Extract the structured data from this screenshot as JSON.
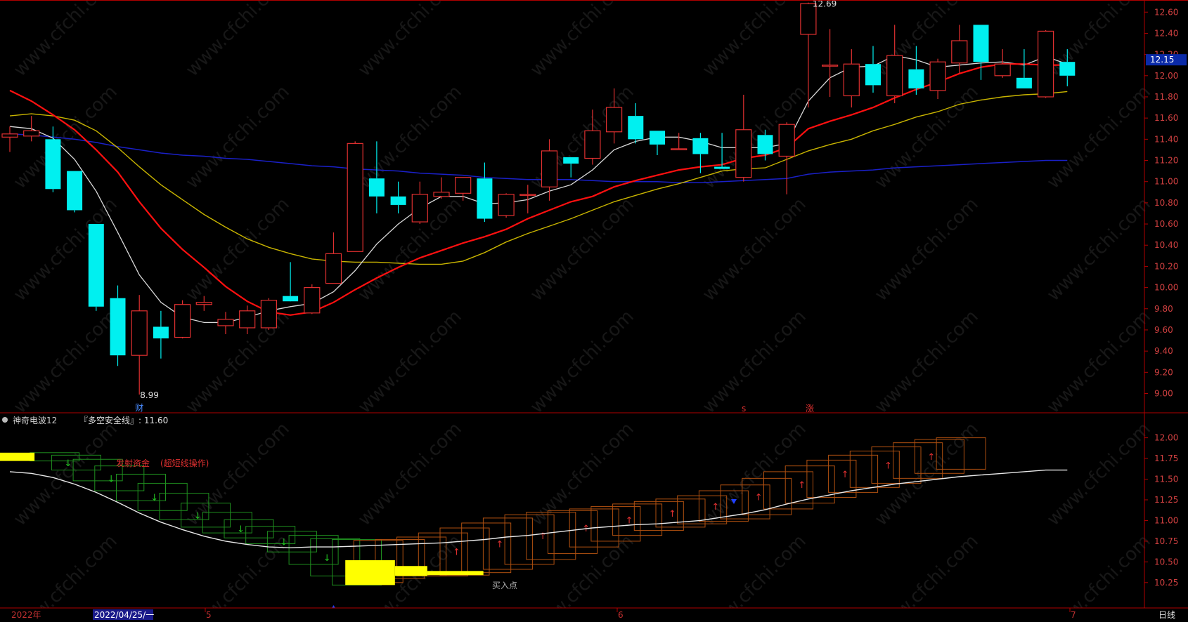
{
  "price_axis": {
    "ticks": [
      "12.60",
      "12.40",
      "12.20",
      "12.00",
      "11.80",
      "11.60",
      "11.40",
      "11.20",
      "11.00",
      "10.80",
      "10.60",
      "10.40",
      "10.20",
      "10.00",
      "9.80",
      "9.60",
      "9.40",
      "9.20",
      "9.00"
    ],
    "current_price": "12.15"
  },
  "markers": {
    "high_label": "12.69",
    "low_label": "8.99",
    "cai_label": "财",
    "s_label": "s",
    "zhang_label": "涨"
  },
  "indicator": {
    "name": "神奇电波12",
    "safety_label": "『多空安全线』: 11.60",
    "sell_text": "发射资金",
    "sell_note": "(超短线操作)",
    "buy_text": "买入点",
    "ticks": [
      "12.00",
      "11.75",
      "11.50",
      "11.25",
      "11.00",
      "10.75",
      "10.50",
      "10.25"
    ]
  },
  "time_axis": {
    "year_label": "2022年",
    "cursor_date": "2022/04/25/一",
    "month_labels": [
      "5",
      "6",
      "7"
    ],
    "period_label": "日线"
  },
  "watermark_text": "www.cfchi.com",
  "colors": {
    "up": "#e03030",
    "down": "#00f0f0",
    "ma_white": "#d8d8d8",
    "ma_red": "#ff1010",
    "ma_yellow": "#c8b400",
    "ma_blue": "#1a20c8",
    "axis_red": "#b00000",
    "yellow_bar": "#ffff00"
  },
  "chart_data": {
    "type": "candlestick",
    "y_range": [
      8.9,
      12.75
    ],
    "candles": [
      {
        "o": 11.42,
        "h": 11.52,
        "l": 11.28,
        "c": 11.45
      },
      {
        "o": 11.43,
        "h": 11.62,
        "l": 11.38,
        "c": 11.48
      },
      {
        "o": 11.4,
        "h": 11.52,
        "l": 10.9,
        "c": 10.93
      },
      {
        "o": 11.1,
        "h": 11.1,
        "l": 10.71,
        "c": 10.73
      },
      {
        "o": 10.6,
        "h": 10.6,
        "l": 9.78,
        "c": 9.82
      },
      {
        "o": 9.9,
        "h": 10.02,
        "l": 9.26,
        "c": 9.36
      },
      {
        "o": 9.36,
        "h": 9.93,
        "l": 8.99,
        "c": 9.78
      },
      {
        "o": 9.63,
        "h": 9.78,
        "l": 9.33,
        "c": 9.52
      },
      {
        "o": 9.53,
        "h": 9.88,
        "l": 9.52,
        "c": 9.84
      },
      {
        "o": 9.84,
        "h": 9.92,
        "l": 9.78,
        "c": 9.86
      },
      {
        "o": 9.64,
        "h": 9.77,
        "l": 9.56,
        "c": 9.7
      },
      {
        "o": 9.62,
        "h": 9.83,
        "l": 9.56,
        "c": 9.78
      },
      {
        "o": 9.62,
        "h": 9.9,
        "l": 9.6,
        "c": 9.88
      },
      {
        "o": 9.92,
        "h": 10.24,
        "l": 9.88,
        "c": 9.87
      },
      {
        "o": 9.76,
        "h": 10.03,
        "l": 9.75,
        "c": 10.0
      },
      {
        "o": 10.04,
        "h": 10.52,
        "l": 10.04,
        "c": 10.32
      },
      {
        "o": 10.34,
        "h": 11.38,
        "l": 10.34,
        "c": 11.36
      },
      {
        "o": 11.03,
        "h": 11.38,
        "l": 10.7,
        "c": 10.86
      },
      {
        "o": 10.86,
        "h": 11.0,
        "l": 10.7,
        "c": 10.78
      },
      {
        "o": 10.62,
        "h": 11.0,
        "l": 10.6,
        "c": 10.88
      },
      {
        "o": 10.86,
        "h": 11.04,
        "l": 10.84,
        "c": 10.9
      },
      {
        "o": 10.89,
        "h": 11.04,
        "l": 10.82,
        "c": 11.04
      },
      {
        "o": 11.03,
        "h": 11.18,
        "l": 10.62,
        "c": 10.65
      },
      {
        "o": 10.68,
        "h": 10.89,
        "l": 10.66,
        "c": 10.88
      },
      {
        "o": 10.88,
        "h": 10.97,
        "l": 10.7,
        "c": 10.88
      },
      {
        "o": 10.95,
        "h": 11.4,
        "l": 10.82,
        "c": 11.29
      },
      {
        "o": 11.23,
        "h": 11.23,
        "l": 11.04,
        "c": 11.17
      },
      {
        "o": 11.22,
        "h": 11.68,
        "l": 11.16,
        "c": 11.48
      },
      {
        "o": 11.47,
        "h": 11.88,
        "l": 11.36,
        "c": 11.7
      },
      {
        "o": 11.62,
        "h": 11.74,
        "l": 11.36,
        "c": 11.4
      },
      {
        "o": 11.48,
        "h": 11.48,
        "l": 11.25,
        "c": 11.35
      },
      {
        "o": 11.31,
        "h": 11.46,
        "l": 11.3,
        "c": 11.31
      },
      {
        "o": 11.41,
        "h": 11.46,
        "l": 11.08,
        "c": 11.26
      },
      {
        "o": 11.14,
        "h": 11.46,
        "l": 11.12,
        "c": 11.12
      },
      {
        "o": 11.04,
        "h": 11.82,
        "l": 11.0,
        "c": 11.49
      },
      {
        "o": 11.44,
        "h": 11.49,
        "l": 11.2,
        "c": 11.26
      },
      {
        "o": 11.24,
        "h": 11.56,
        "l": 10.88,
        "c": 11.54
      },
      {
        "o": 12.39,
        "h": 12.69,
        "l": 11.7,
        "c": 12.68
      },
      {
        "o": 12.09,
        "h": 12.44,
        "l": 11.8,
        "c": 12.1
      },
      {
        "o": 11.81,
        "h": 12.25,
        "l": 11.7,
        "c": 12.11
      },
      {
        "o": 12.11,
        "h": 12.28,
        "l": 11.84,
        "c": 11.91
      },
      {
        "o": 11.81,
        "h": 12.48,
        "l": 11.74,
        "c": 12.19
      },
      {
        "o": 12.06,
        "h": 12.28,
        "l": 11.82,
        "c": 11.88
      },
      {
        "o": 11.86,
        "h": 12.16,
        "l": 11.78,
        "c": 12.13
      },
      {
        "o": 12.12,
        "h": 12.48,
        "l": 12.02,
        "c": 12.33
      },
      {
        "o": 12.48,
        "h": 12.48,
        "l": 11.96,
        "c": 12.13
      },
      {
        "o": 12.0,
        "h": 12.25,
        "l": 11.98,
        "c": 12.11
      },
      {
        "o": 11.98,
        "h": 12.25,
        "l": 11.88,
        "c": 11.88
      },
      {
        "o": 11.8,
        "h": 12.43,
        "l": 11.79,
        "c": 12.42
      },
      {
        "o": 12.13,
        "h": 12.25,
        "l": 11.9,
        "c": 12.0
      }
    ],
    "ma_white": [
      11.52,
      11.5,
      11.41,
      11.21,
      10.91,
      10.52,
      10.12,
      9.86,
      9.72,
      9.67,
      9.67,
      9.72,
      9.78,
      9.82,
      9.85,
      9.96,
      10.16,
      10.41,
      10.6,
      10.75,
      10.86,
      10.86,
      10.79,
      10.8,
      10.83,
      10.91,
      10.97,
      11.11,
      11.3,
      11.38,
      11.42,
      11.42,
      11.38,
      11.32,
      11.32,
      11.32,
      11.36,
      11.76,
      11.98,
      12.08,
      12.09,
      12.19,
      12.15,
      12.08,
      12.1,
      12.12,
      12.13,
      12.1,
      12.18,
      12.11
    ],
    "ma_red": [
      11.86,
      11.76,
      11.63,
      11.49,
      11.3,
      11.09,
      10.81,
      10.56,
      10.36,
      10.19,
      10.01,
      9.87,
      9.77,
      9.74,
      9.77,
      9.86,
      9.98,
      10.09,
      10.19,
      10.28,
      10.35,
      10.42,
      10.48,
      10.55,
      10.65,
      10.73,
      10.81,
      10.86,
      10.95,
      11.01,
      11.06,
      11.11,
      11.14,
      11.16,
      11.22,
      11.25,
      11.32,
      11.5,
      11.57,
      11.63,
      11.7,
      11.79,
      11.87,
      11.94,
      12.02,
      12.08,
      12.11,
      12.11,
      12.1,
      12.1
    ],
    "ma_yellow": [
      11.62,
      11.64,
      11.62,
      11.58,
      11.48,
      11.32,
      11.14,
      10.97,
      10.83,
      10.69,
      10.57,
      10.46,
      10.38,
      10.32,
      10.27,
      10.25,
      10.24,
      10.24,
      10.23,
      10.22,
      10.22,
      10.25,
      10.33,
      10.43,
      10.51,
      10.58,
      10.65,
      10.73,
      10.81,
      10.87,
      10.93,
      10.98,
      11.04,
      11.1,
      11.12,
      11.13,
      11.21,
      11.29,
      11.35,
      11.4,
      11.48,
      11.54,
      11.61,
      11.66,
      11.73,
      11.77,
      11.8,
      11.82,
      11.83,
      11.85
    ],
    "ma_blue": [
      11.45,
      11.44,
      11.42,
      11.4,
      11.37,
      11.33,
      11.3,
      11.27,
      11.25,
      11.24,
      11.22,
      11.21,
      11.19,
      11.17,
      11.15,
      11.14,
      11.12,
      11.11,
      11.1,
      11.08,
      11.07,
      11.06,
      11.04,
      11.03,
      11.02,
      11.02,
      11.02,
      11.01,
      11.0,
      11.0,
      11.0,
      10.99,
      10.99,
      11.0,
      11.01,
      11.02,
      11.03,
      11.07,
      11.09,
      11.1,
      11.11,
      11.13,
      11.14,
      11.15,
      11.16,
      11.17,
      11.18,
      11.19,
      11.2,
      11.2
    ],
    "indicator": {
      "y_range": [
        10.12,
        12.25
      ],
      "white_line": [
        11.59,
        11.57,
        11.52,
        11.44,
        11.34,
        11.22,
        11.09,
        10.98,
        10.89,
        10.81,
        10.75,
        10.71,
        10.68,
        10.67,
        10.68,
        10.68,
        10.69,
        10.7,
        10.71,
        10.72,
        10.73,
        10.75,
        10.77,
        10.8,
        10.82,
        10.85,
        10.88,
        10.91,
        10.93,
        10.95,
        10.96,
        10.98,
        11.0,
        11.04,
        11.08,
        11.13,
        11.2,
        11.26,
        11.31,
        11.36,
        11.4,
        11.44,
        11.47,
        11.5,
        11.53,
        11.55,
        11.57,
        11.59,
        11.61,
        11.61
      ],
      "box_highs": [
        11.82,
        11.79,
        11.74,
        11.66,
        11.56,
        11.45,
        11.33,
        11.21,
        11.1,
        11.01,
        10.93,
        10.87,
        10.82,
        10.78,
        10.77,
        10.76,
        10.77,
        10.8,
        10.85,
        10.91,
        10.97,
        11.03,
        11.07,
        11.1,
        11.12,
        11.14,
        11.17,
        11.2,
        11.23,
        11.26,
        11.3,
        11.36,
        11.43,
        11.51,
        11.59,
        11.66,
        11.73,
        11.79,
        11.84,
        11.89,
        11.94,
        11.98,
        12.0
      ],
      "box_lows": [
        11.72,
        11.61,
        11.48,
        11.36,
        11.24,
        11.12,
        11.01,
        10.92,
        10.85,
        10.79,
        10.72,
        10.62,
        10.47,
        10.33,
        10.22,
        10.25,
        10.3,
        10.33,
        10.33,
        10.34,
        10.37,
        10.41,
        10.47,
        10.53,
        10.6,
        10.68,
        10.75,
        10.82,
        10.88,
        10.92,
        10.96,
        10.99,
        11.02,
        11.07,
        11.14,
        11.21,
        11.28,
        11.34,
        11.4,
        11.45,
        11.51,
        11.57,
        11.62
      ],
      "yellow_blocks": [
        {
          "i0": 0,
          "i1": 1.6,
          "lo": 11.72,
          "hi": 11.82
        },
        {
          "i0": 16,
          "i1": 18.3,
          "lo": 10.22,
          "hi": 10.52
        },
        {
          "i0": 18.3,
          "i1": 19.8,
          "lo": 10.33,
          "hi": 10.45
        },
        {
          "i0": 19.8,
          "i1": 22.4,
          "lo": 10.34,
          "hi": 10.39
        }
      ]
    }
  }
}
